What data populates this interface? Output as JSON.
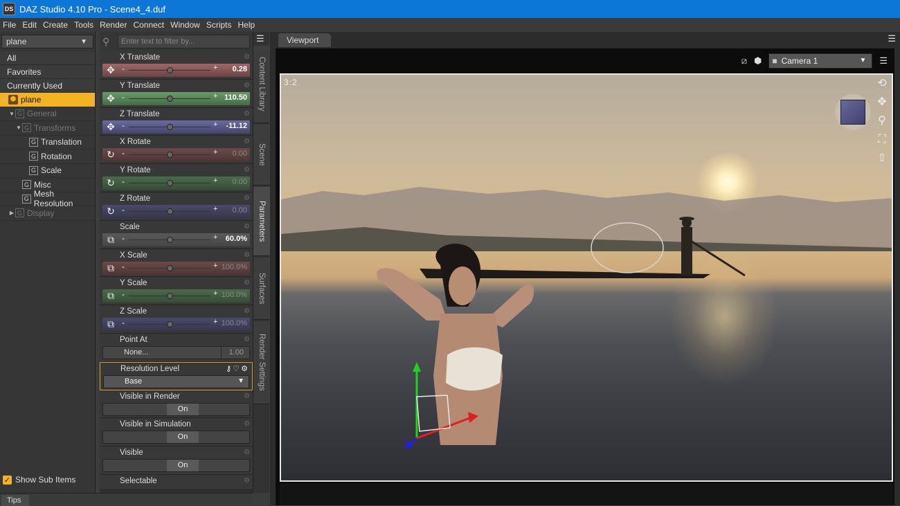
{
  "window": {
    "title": "DAZ Studio 4.10 Pro - Scene4_4.duf",
    "logo": "DS"
  },
  "menu": [
    "File",
    "Edit",
    "Create",
    "Tools",
    "Render",
    "Connect",
    "Window",
    "Scripts",
    "Help"
  ],
  "scene_panel": {
    "selector": "plane",
    "filters": [
      "All",
      "Favorites",
      "Currently Used"
    ],
    "tree": [
      {
        "label": "plane",
        "level": 0,
        "selected": true,
        "type": "node"
      },
      {
        "label": "General",
        "level": 1,
        "dim": true,
        "type": "group"
      },
      {
        "label": "Transforms",
        "level": 2,
        "dim": true,
        "type": "group"
      },
      {
        "label": "Translation",
        "level": 3,
        "type": "group"
      },
      {
        "label": "Rotation",
        "level": 3,
        "type": "group"
      },
      {
        "label": "Scale",
        "level": 3,
        "type": "group"
      },
      {
        "label": "Misc",
        "level": 2,
        "type": "group"
      },
      {
        "label": "Mesh Resolution",
        "level": 2,
        "type": "group"
      },
      {
        "label": "Display",
        "level": 1,
        "dim": true,
        "type": "group"
      }
    ],
    "show_sub_items": "Show Sub Items"
  },
  "parameters": {
    "filter_placeholder": "Enter text to filter by...",
    "sliders": [
      {
        "name": "X Translate",
        "value": "0.28",
        "color": "red",
        "icon": "move-icon"
      },
      {
        "name": "Y Translate",
        "value": "110.50",
        "color": "green",
        "icon": "move-icon"
      },
      {
        "name": "Z Translate",
        "value": "-11.12",
        "color": "blue",
        "icon": "move-icon"
      },
      {
        "name": "X Rotate",
        "value": "0.00",
        "color": "dred",
        "icon": "rotate-icon",
        "dim": true
      },
      {
        "name": "Y Rotate",
        "value": "0.00",
        "color": "dgreen",
        "icon": "rotate-icon",
        "dim": true
      },
      {
        "name": "Z Rotate",
        "value": "0.00",
        "color": "dblue",
        "icon": "rotate-icon",
        "dim": true
      },
      {
        "name": "Scale",
        "value": "60.0%",
        "color": "gray",
        "icon": "scale-icon"
      },
      {
        "name": "X Scale",
        "value": "100.0%",
        "color": "dred",
        "icon": "scale-icon",
        "dim": true
      },
      {
        "name": "Y Scale",
        "value": "100.0%",
        "color": "dgreen",
        "icon": "scale-icon",
        "dim": true
      },
      {
        "name": "Z Scale",
        "value": "100.0%",
        "color": "dblue",
        "icon": "scale-icon",
        "dim": true
      }
    ],
    "point_at": {
      "name": "Point At",
      "value": "None...",
      "number": "1.00"
    },
    "resolution": {
      "name": "Resolution Level",
      "value": "Base"
    },
    "toggles": [
      {
        "name": "Visible in Render",
        "value": "On"
      },
      {
        "name": "Visible in Simulation",
        "value": "On"
      },
      {
        "name": "Visible",
        "value": "On"
      }
    ],
    "last": "Selectable"
  },
  "vertical_tabs": [
    "Content Library",
    "Scene",
    "Parameters",
    "Surfaces",
    "Render Settings"
  ],
  "viewport": {
    "tab": "Viewport",
    "camera": "Camera 1",
    "aspect": "3:2"
  },
  "tips": "Tips"
}
